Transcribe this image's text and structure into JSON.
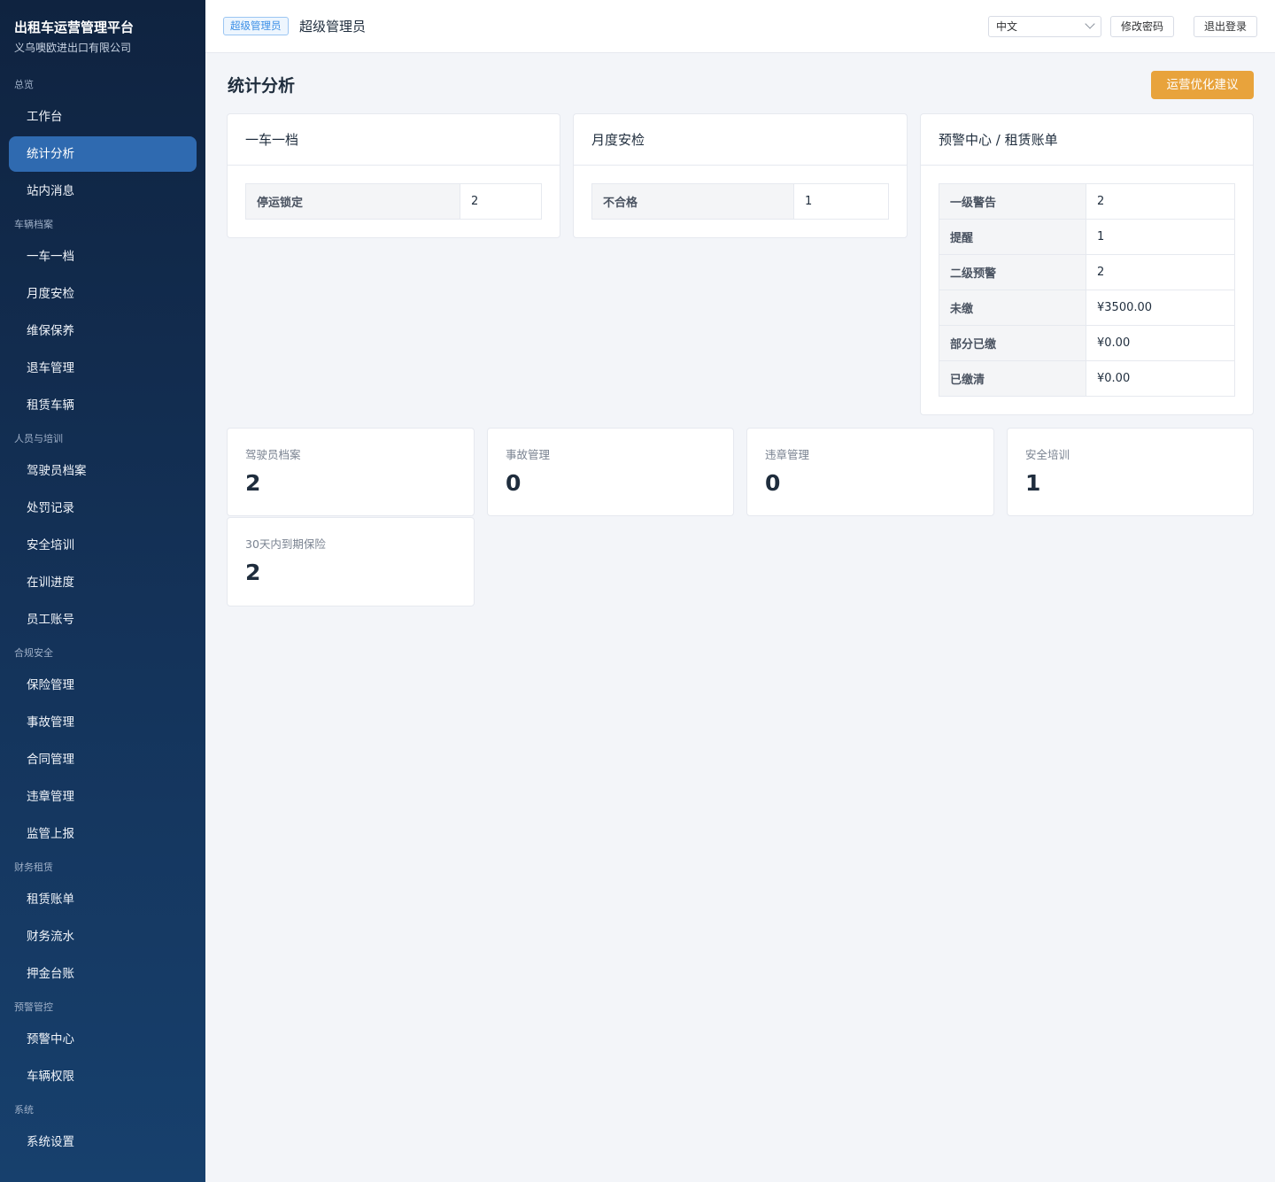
{
  "brand": {
    "title": "出租车运营管理平台",
    "subtitle": "义乌噢欧进出口有限公司"
  },
  "sidebar": {
    "groups": [
      {
        "label": "总览",
        "items": [
          "工作台",
          "统计分析",
          "站内消息"
        ]
      },
      {
        "label": "车辆档案",
        "items": [
          "一车一档",
          "月度安检",
          "维保保养",
          "退车管理",
          "租赁车辆"
        ]
      },
      {
        "label": "人员与培训",
        "items": [
          "驾驶员档案",
          "处罚记录",
          "安全培训",
          "在训进度",
          "员工账号"
        ]
      },
      {
        "label": "合规安全",
        "items": [
          "保险管理",
          "事故管理",
          "合同管理",
          "违章管理",
          "监管上报"
        ]
      },
      {
        "label": "财务租赁",
        "items": [
          "租赁账单",
          "财务流水",
          "押金台账"
        ]
      },
      {
        "label": "预警管控",
        "items": [
          "预警中心",
          "车辆权限"
        ]
      },
      {
        "label": "系统",
        "items": [
          "系统设置"
        ]
      }
    ],
    "active": "统计分析"
  },
  "header": {
    "role_badge": "超级管理员",
    "role_name": "超级管理员",
    "language": "中文",
    "change_password": "修改密码",
    "logout": "退出登录"
  },
  "main": {
    "title": "统计分析",
    "advice_button": "运营优化建议",
    "cards": [
      {
        "title": "一车一档",
        "rows": [
          {
            "k": "停运锁定",
            "v": "2"
          }
        ]
      },
      {
        "title": "月度安检",
        "rows": [
          {
            "k": "不合格",
            "v": "1"
          }
        ]
      },
      {
        "title": "预警中心 / 租赁账单",
        "rows": [
          {
            "k": "一级警告",
            "v": "2"
          },
          {
            "k": "提醒",
            "v": "1"
          },
          {
            "k": "二级预警",
            "v": "2"
          },
          {
            "k": "未缴",
            "v": "¥3500.00"
          },
          {
            "k": "部分已缴",
            "v": "¥0.00"
          },
          {
            "k": "已缴清",
            "v": "¥0.00"
          }
        ]
      }
    ],
    "stats": [
      {
        "label": "驾驶员档案",
        "value": "2"
      },
      {
        "label": "事故管理",
        "value": "0"
      },
      {
        "label": "违章管理",
        "value": "0"
      },
      {
        "label": "安全培训",
        "value": "1"
      },
      {
        "label": "30天内到期保险",
        "value": "2"
      }
    ]
  }
}
